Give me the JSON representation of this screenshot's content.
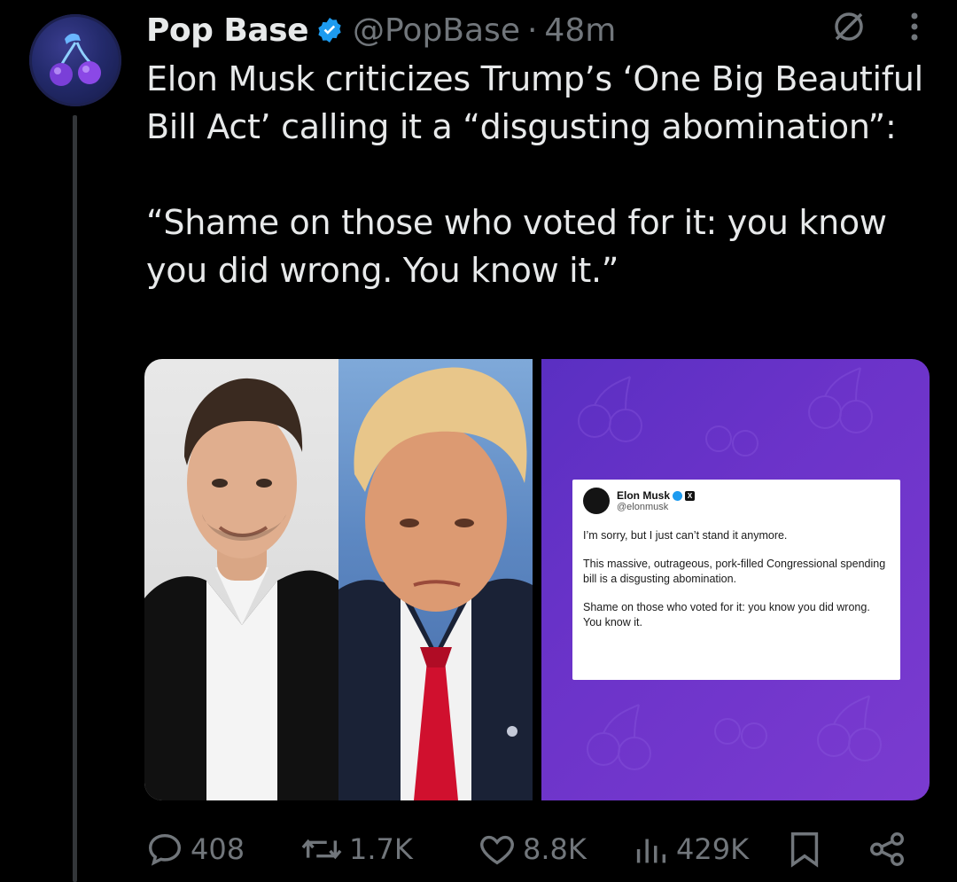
{
  "post": {
    "display_name": "Pop Base",
    "handle": "@PopBase",
    "separator": "·",
    "time": "48m",
    "text_paragraph_1": "Elon Musk criticizes Trump’s ‘One Big Beautiful Bill Act’ calling it a “disgusting abomination”:",
    "text_paragraph_2": "“Shame on those who voted for it: you know you did wrong. You know it.”"
  },
  "embedded_tweet": {
    "name": "Elon Musk",
    "handle": "@elonmusk",
    "x_badge": "X",
    "line_1": "I’m sorry, but I just can’t stand it anymore.",
    "line_2": "This massive, outrageous, pork-filled Congressional spending bill is a disgusting abomination.",
    "line_3": "Shame on those who voted for it: you know you did wrong. You know it."
  },
  "actions": {
    "replies": "408",
    "reposts": "1.7K",
    "likes": "8.8K",
    "views": "429K"
  },
  "icons": [
    "avatar-cherry",
    "verified-badge-icon",
    "grok-icon",
    "more-icon",
    "reply-icon",
    "repost-icon",
    "like-icon",
    "views-icon",
    "bookmark-icon",
    "share-icon"
  ],
  "colors": {
    "background": "#000000",
    "text": "#e7e9ea",
    "secondary": "#71767b",
    "verified": "#1d9bf0",
    "purple": "#6b33c9",
    "red_tie": "#d0102e"
  }
}
